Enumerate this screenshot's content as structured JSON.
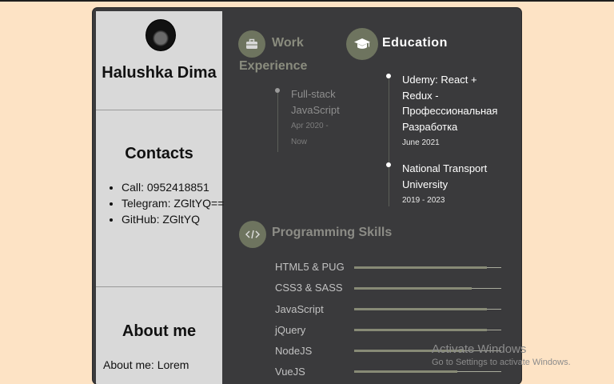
{
  "sidebar": {
    "name": "Halushka Dima",
    "contacts_title": "Contacts",
    "contacts": [
      "Call: 0952418851",
      "Telegram: ZGltYQ==",
      "GitHub: ZGltYQ"
    ],
    "about_title": "About me",
    "about_text": "About me: Lorem"
  },
  "work": {
    "title_line1": "Work",
    "title_line2": "Experience",
    "entries": [
      {
        "title_line1": "Full-stack",
        "title_line2": "JavaScript",
        "date_line1": "Apr 2020 -",
        "date_line2": "Now"
      }
    ]
  },
  "education": {
    "title": "Education",
    "entries": [
      {
        "lines": [
          "Udemy: React +",
          "Redux -",
          "Профессиональная",
          "Разработка"
        ],
        "date": "June 2021"
      },
      {
        "lines": [
          "National Transport",
          "University"
        ],
        "date": "2019 - 2023"
      }
    ]
  },
  "skills": {
    "title": "Programming Skills",
    "items": [
      {
        "name": "HTML5 & PUG",
        "level": 0.9
      },
      {
        "name": "CSS3 & SASS",
        "level": 0.8
      },
      {
        "name": "JavaScript",
        "level": 0.9
      },
      {
        "name": "jQuery",
        "level": 0.9
      },
      {
        "name": "NodeJS",
        "level": 0.75
      },
      {
        "name": "VueJS",
        "level": 0.7
      }
    ]
  },
  "watermark": {
    "line1": "Activate Windows",
    "line2": "Go to Settings to activate Windows."
  },
  "icons": {
    "work": "briefcase-icon",
    "education": "graduation-cap-icon",
    "skills": "code-icon"
  },
  "colors": {
    "page_bg": "#fde3c5",
    "card_bg": "#3a3a3c",
    "sidebar_bg": "#d9d9d9",
    "accent": "#6e745f"
  }
}
